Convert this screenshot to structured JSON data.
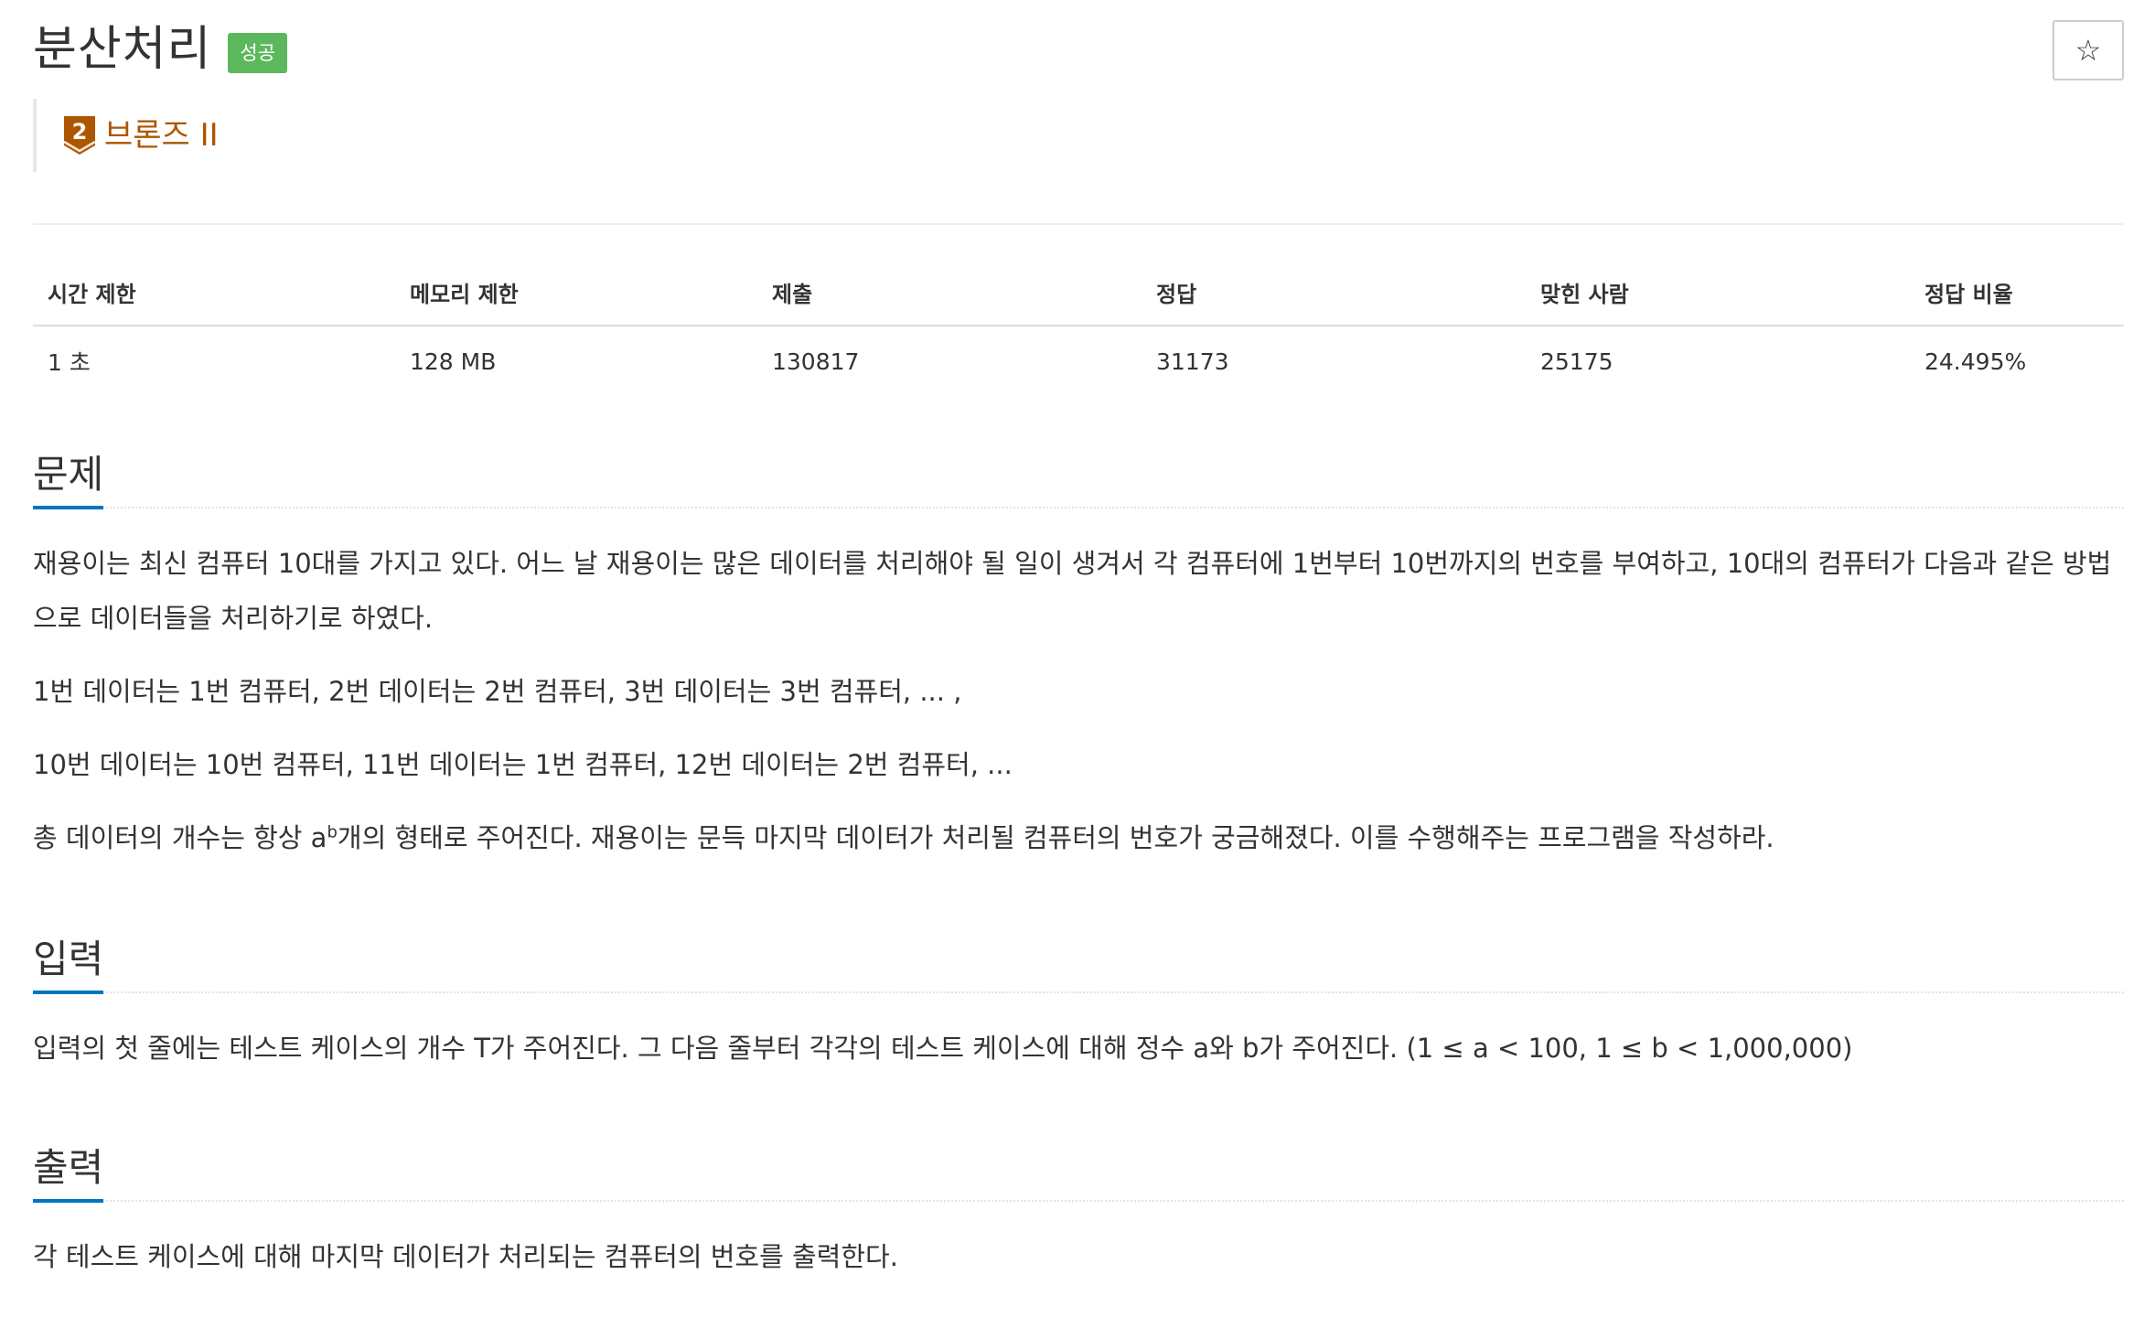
{
  "problem": {
    "title": "분산처리",
    "result_badge": "성공",
    "star_glyph": "☆",
    "tier": {
      "label": "브론즈 II",
      "number": "2",
      "color": "#ad5600"
    }
  },
  "info_table": {
    "headers": [
      "시간 제한",
      "메모리 제한",
      "제출",
      "정답",
      "맞힌 사람",
      "정답 비율"
    ],
    "values": [
      "1 초",
      "128 MB",
      "130817",
      "31173",
      "25175",
      "24.495%"
    ]
  },
  "sections": {
    "description": {
      "title": "문제",
      "p1": "재용이는 최신 컴퓨터 10대를 가지고 있다. 어느 날 재용이는 많은 데이터를 처리해야 될 일이 생겨서 각 컴퓨터에 1번부터 10번까지의 번호를 부여하고, 10대의 컴퓨터가 다음과 같은 방법으로 데이터들을 처리하기로 하였다.",
      "p2": "1번 데이터는 1번 컴퓨터, 2번 데이터는 2번 컴퓨터, 3번 데이터는 3번 컴퓨터, ... ,",
      "p3": "10번 데이터는 10번 컴퓨터, 11번 데이터는 1번 컴퓨터, 12번 데이터는 2번 컴퓨터, ...",
      "p4_before": "총 데이터의 개수는 항상 a",
      "p4_sup": "b",
      "p4_after": "개의 형태로 주어진다. 재용이는 문득 마지막 데이터가 처리될 컴퓨터의 번호가 궁금해졌다. 이를 수행해주는 프로그램을 작성하라."
    },
    "input": {
      "title": "입력",
      "p1": "입력의 첫 줄에는 테스트 케이스의 개수 T가 주어진다. 그 다음 줄부터 각각의 테스트 케이스에 대해 정수 a와 b가 주어진다. (1 ≤ a < 100, 1 ≤ b < 1,000,000)"
    },
    "output": {
      "title": "출력",
      "p1": "각 테스트 케이스에 대해 마지막 데이터가 처리되는 컴퓨터의 번호를 출력한다."
    }
  },
  "colors": {
    "success_badge": "#5cb85c",
    "section_underline": "#0076c0",
    "bronze": "#ad5600"
  }
}
